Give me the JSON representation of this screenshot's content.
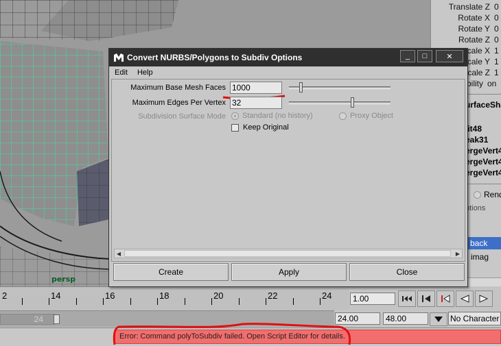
{
  "viewport": {
    "camera_label": "persp"
  },
  "channel_box": {
    "attributes": [
      {
        "name": "Translate Z",
        "value": "0"
      },
      {
        "name": "Rotate X",
        "value": "0"
      },
      {
        "name": "Rotate Y",
        "value": "0"
      },
      {
        "name": "Rotate Z",
        "value": "0"
      },
      {
        "name": "cale X",
        "value": "1"
      },
      {
        "name": "cale Y",
        "value": "1"
      },
      {
        "name": "cale Z",
        "value": "1"
      },
      {
        "name": "isibility",
        "value": "on"
      }
    ],
    "shape_node": "urfaceSha",
    "history": [
      "lit48",
      "eak31",
      "ergeVert4",
      "ergeVert4",
      "ergeVert4"
    ],
    "render_radio": "Rend",
    "options_label": "ptions",
    "layers": [
      "back",
      "imag"
    ]
  },
  "dialog": {
    "title": "Convert NURBS/Polygons to Subdiv Options",
    "menu": [
      "Edit",
      "Help"
    ],
    "max_base_mesh_faces": {
      "label": "Maximum Base Mesh Faces",
      "value": "1000"
    },
    "max_edges_per_vertex": {
      "label": "Maximum Edges Per Vertex",
      "value": "32"
    },
    "surface_mode": {
      "label": "Subdivision Surface Mode",
      "options": [
        "Standard (no history)",
        "Proxy Object"
      ],
      "selected": "Standard (no history)"
    },
    "keep_original": {
      "label": "Keep Original",
      "checked": false
    },
    "buttons": {
      "create": "Create",
      "apply": "Apply",
      "close": "Close"
    },
    "window_buttons": {
      "minimize": "_",
      "maximize": "□",
      "close": "✕"
    }
  },
  "timeline": {
    "ticks": [
      "2",
      "14",
      "16",
      "18",
      "20",
      "22",
      "24"
    ],
    "current_frame": "1.00"
  },
  "range": {
    "slider_value": "24",
    "end_time": "24.00",
    "playback_end": "48.00",
    "character_set": "No Character Se"
  },
  "command_line": {
    "error": "Error: Command polyToSubdiv failed. Open Script Editor for details."
  },
  "colors": {
    "error_bg": "#f26e6e",
    "annotation_red": "#e01010",
    "wireframe": "#3fe0a0",
    "layer_selected": "#3e6fc8"
  }
}
